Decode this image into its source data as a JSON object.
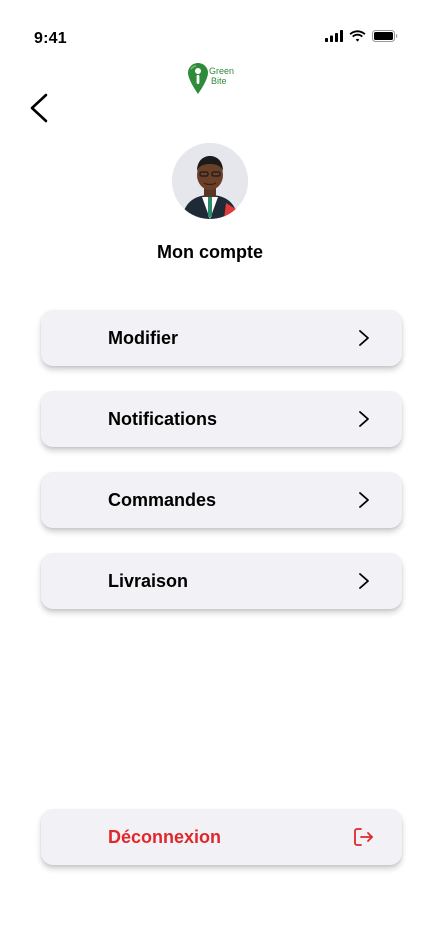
{
  "status_bar": {
    "time": "9:41"
  },
  "logo": {
    "line1": "Green",
    "line2": "Bite",
    "color": "#2e8b3a"
  },
  "page_title": "Mon compte",
  "menu": [
    {
      "label": "Modifier",
      "icon": "chevron-right-icon"
    },
    {
      "label": "Notifications",
      "icon": "chevron-right-icon"
    },
    {
      "label": "Commandes",
      "icon": "chevron-right-icon"
    },
    {
      "label": "Livraison",
      "icon": "chevron-right-icon"
    }
  ],
  "logout": {
    "label": "Déconnexion",
    "icon": "logout-icon",
    "color": "#e0272b"
  },
  "colors": {
    "button_bg": "#f2f2f6",
    "accent_green": "#2e8b3a",
    "danger": "#e0272b"
  }
}
